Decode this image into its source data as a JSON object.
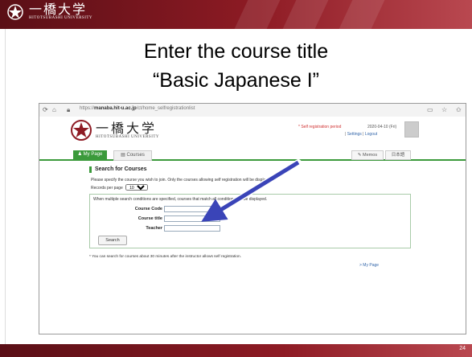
{
  "slide": {
    "title_line1": "Enter the course title",
    "title_line2": "“Basic Japanese I”",
    "page_number": "24",
    "header_logo": {
      "name_jp": "一橋大学",
      "name_en": "HITOTSUBASHI UNIVERSITY"
    },
    "colors": {
      "brand": "#8e1b24",
      "accent_green": "#3b9a3b",
      "arrow": "#3a44b8"
    }
  },
  "browser": {
    "url_prefix": "https://",
    "url_host": "manaba.hit-u.ac.jp",
    "url_path": "/ct/home_selfregistrationlist"
  },
  "site": {
    "logo": {
      "name_jp": "一橋大学",
      "name_en": "HITOTSUBASHI UNIVERSITY"
    },
    "self_registration": "* Self registration period",
    "datetime": "2020-04-10 (Fri)",
    "settings": "Settings",
    "logout": "Logout",
    "nav": {
      "my_page": "My Page",
      "courses": "Courses",
      "memos": "Memos",
      "language": "日本語"
    }
  },
  "search": {
    "heading": "Search for Courses",
    "description": "Please specify the course you wish to join. Only the courses allowing self registration will be displayed.",
    "records_label": "Records per page",
    "records_value": "10",
    "conditions_note": "When multiple search conditions are specified, courses that match all conditions will be displayed.",
    "course_code_label": "Course Code",
    "course_title_label": "Course title",
    "teacher_label": "Teacher",
    "search_button": "Search",
    "footnote": "* You can search for courses about 30 minutes after the instructor allows self registration.",
    "my_page_link": "> My Page"
  }
}
